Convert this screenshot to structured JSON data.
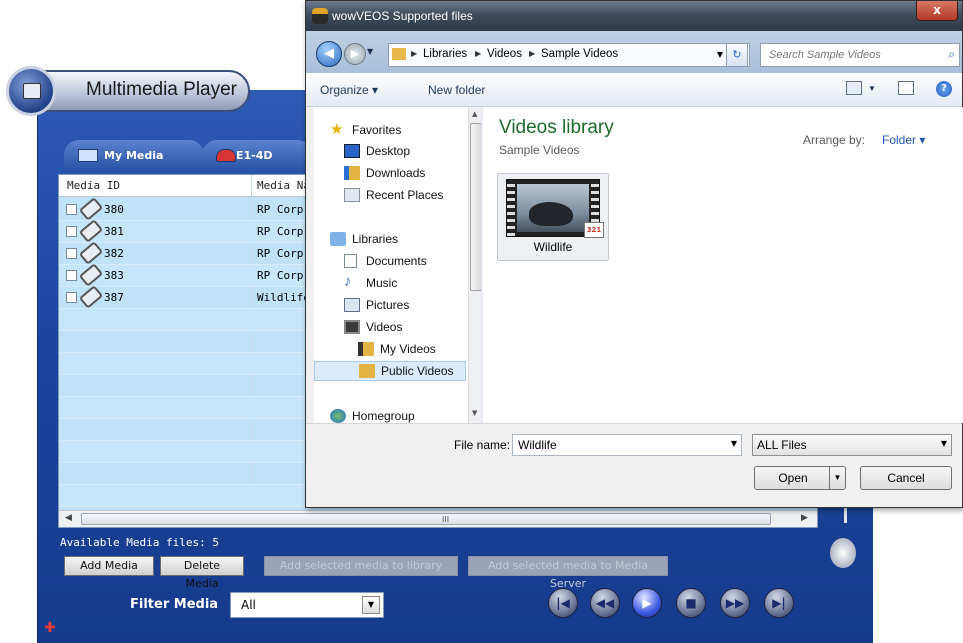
{
  "player": {
    "title": "Multimedia Player",
    "tabs": [
      {
        "label": "My Media"
      },
      {
        "label": "E1-4D"
      }
    ],
    "table": {
      "columns": [
        "Media ID",
        "Media Na"
      ],
      "rows": [
        {
          "id": "380",
          "name": "RP Corp"
        },
        {
          "id": "381",
          "name": "RP Corp"
        },
        {
          "id": "382",
          "name": "RP Corp"
        },
        {
          "id": "383",
          "name": "RP Corp"
        },
        {
          "id": "387",
          "name": "Wildlife.͡"
        }
      ],
      "scroll_grip": "III"
    },
    "count_text": "Available Media files: 5",
    "buttons": {
      "add_media": "Add Media",
      "delete_media": "Delete Media",
      "add_library": "Add selected media to library",
      "add_device": "Add selected media to Media Server"
    },
    "filter": {
      "label": "Filter Media",
      "value": "All"
    },
    "controls": [
      "previous-track",
      "rewind",
      "play",
      "stop",
      "fast-forward",
      "next-track"
    ]
  },
  "dialog": {
    "title": "wowVEOS Supported files",
    "close_label": "x",
    "breadcrumb": [
      "Libraries",
      "Videos",
      "Sample Videos"
    ],
    "search_placeholder": "Search Sample Videos",
    "toolbar": {
      "organize": "Organize ▾",
      "new_folder": "New folder"
    },
    "nav": {
      "favorites_label": "Favorites",
      "favorites": [
        "Desktop",
        "Downloads",
        "Recent Places"
      ],
      "libraries_label": "Libraries",
      "libraries": [
        "Documents",
        "Music",
        "Pictures",
        "Videos"
      ],
      "video_children": [
        "My Videos",
        "Public Videos"
      ],
      "homegroup_label": "Homegroup",
      "selected": "Public Videos"
    },
    "content": {
      "library_title": "Videos library",
      "library_subtitle": "Sample Videos",
      "arrange_label": "Arrange by:",
      "arrange_value": "Folder ▾",
      "files": [
        {
          "name": "Wildlife",
          "badge": "321"
        }
      ]
    },
    "footer": {
      "file_name_label": "File name:",
      "file_name_value": "Wildlife",
      "file_type_value": "ALL Files",
      "open_label": "Open",
      "cancel_label": "Cancel"
    }
  },
  "colors": {
    "player_bg": "#1e46a0",
    "list_bg": "#bfe2f7",
    "library_title": "#1e6a2c",
    "link_blue": "#1c56b3"
  }
}
